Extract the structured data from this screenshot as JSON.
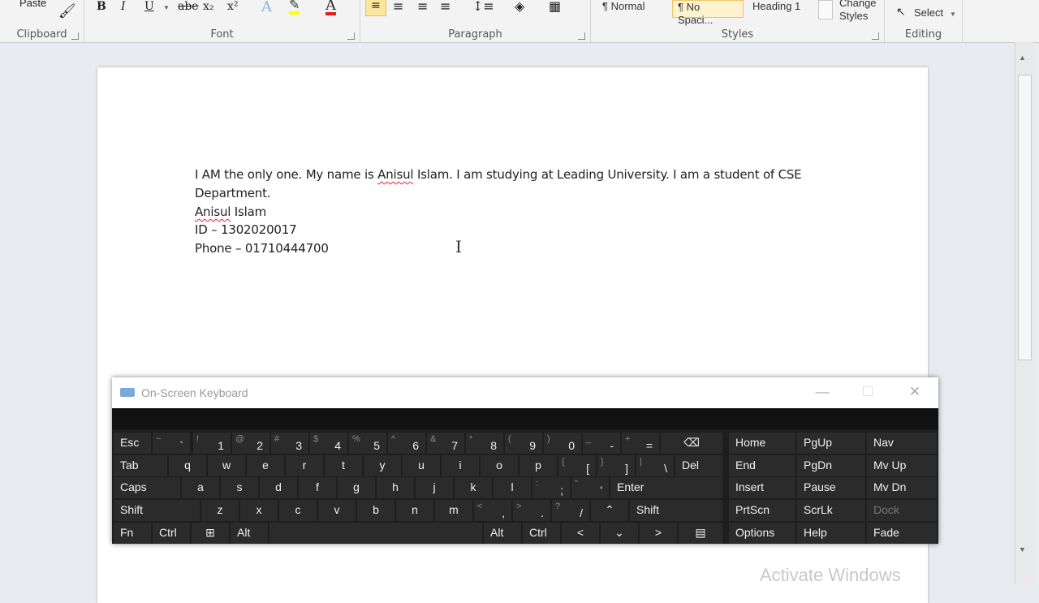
{
  "ribbon": {
    "clipboard": {
      "paste": "Paste",
      "label": "Clipboard"
    },
    "font": {
      "bold": "B",
      "italic": "I",
      "underline": "U",
      "strike": "abe",
      "subscript": "x₂",
      "superscript": "x²",
      "font_color": "A",
      "label": "Font"
    },
    "paragraph": {
      "label": "Paragraph"
    },
    "styles": {
      "normal": "¶ Normal",
      "no_spacing": "¶ No Spaci...",
      "heading1": "Heading 1",
      "change_styles_1": "Change",
      "change_styles_2": "Styles",
      "label": "Styles"
    },
    "editing": {
      "select": "Select",
      "label": "Editing"
    }
  },
  "document": {
    "line1": "I AM the only one. My name is ",
    "line1_name": "Anisul",
    "line1_rest": " Islam. I am studying at Leading University. I am a student of CSE",
    "line2": "Department.",
    "line3_name": "Anisul",
    "line3_rest": " Islam",
    "line4": "ID – 1302020017",
    "line5": "Phone – 01710444700"
  },
  "osk": {
    "title": "On-Screen Keyboard",
    "minimize": "—",
    "maximize": "☐",
    "close": "✕",
    "row1": [
      {
        "main": "Esc"
      },
      {
        "sec": "~",
        "base": "`"
      },
      {
        "sec": "!",
        "base": "1"
      },
      {
        "sec": "@",
        "base": "2"
      },
      {
        "sec": "#",
        "base": "3"
      },
      {
        "sec": "$",
        "base": "4"
      },
      {
        "sec": "%",
        "base": "5"
      },
      {
        "sec": "^",
        "base": "6"
      },
      {
        "sec": "&",
        "base": "7"
      },
      {
        "sec": "*",
        "base": "8"
      },
      {
        "sec": "(",
        "base": "9"
      },
      {
        "sec": ")",
        "base": "0"
      },
      {
        "sec": "_",
        "base": "-"
      },
      {
        "sec": "+",
        "base": "="
      },
      {
        "main": "⌫"
      }
    ],
    "row2": [
      "Tab",
      "q",
      "w",
      "e",
      "r",
      "t",
      "y",
      "u",
      "i",
      "o",
      "p"
    ],
    "row2_brackets": [
      {
        "sec": "{",
        "base": "["
      },
      {
        "sec": "}",
        "base": "]"
      },
      {
        "sec": "|",
        "base": "\\"
      }
    ],
    "row2_del": "Del",
    "row3": [
      "Caps",
      "a",
      "s",
      "d",
      "f",
      "g",
      "h",
      "j",
      "k",
      "l"
    ],
    "row3_punct": [
      {
        "sec": ":",
        "base": ";"
      },
      {
        "sec": "\"",
        "base": "'"
      }
    ],
    "row3_enter": "Enter",
    "row4": [
      "Shift",
      "z",
      "x",
      "c",
      "v",
      "b",
      "n",
      "m"
    ],
    "row4_punct": [
      {
        "sec": "<",
        "base": ","
      },
      {
        "sec": ">",
        "base": "."
      },
      {
        "sec": "?",
        "base": "/"
      }
    ],
    "row4_up": "⌃",
    "row4_shift": "Shift",
    "row5": {
      "fn": "Fn",
      "ctrl": "Ctrl",
      "win": "⊞",
      "alt": "Alt",
      "alt_r": "Alt",
      "ctrl_r": "Ctrl",
      "left": "<",
      "down": "⌄",
      "right": ">",
      "menu": "▤"
    },
    "nav": [
      [
        "Home",
        "PgUp",
        "Nav"
      ],
      [
        "End",
        "PgDn",
        "Mv Up"
      ],
      [
        "Insert",
        "Pause",
        "Mv Dn"
      ],
      [
        "PrtScn",
        "ScrLk",
        "Dock"
      ],
      [
        "Options",
        "Help",
        "Fade"
      ]
    ]
  },
  "watermark": "Activate Windows"
}
